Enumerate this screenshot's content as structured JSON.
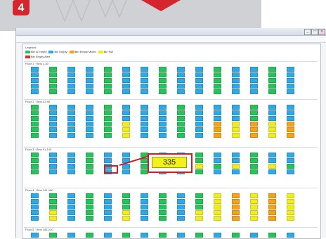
{
  "step_badge": {
    "number": "4",
    "color": "#d5262e"
  },
  "callout": {
    "value": "335"
  },
  "legend": {
    "title": "Legends",
    "items": [
      {
        "label": "Bin Is Empty",
        "color": "#26c35a"
      },
      {
        "label": "Bin Empty",
        "color": "#2fa8e6"
      },
      {
        "label": "Bin Empty Mixed",
        "color": "#f3a21b"
      },
      {
        "label": "Bin Full",
        "color": "#f0ec22"
      },
      {
        "label": "Bin Empty Alert",
        "color": "#e22a2a"
      }
    ]
  },
  "sections": [
    {
      "title": "Floor 1 · Bins 1-40"
    },
    {
      "title": "Floor 2 · Bins 41-90"
    },
    {
      "title": "Floor 3 · Bins 91-140"
    },
    {
      "title": "Floor 4 · Bins 141-180"
    },
    {
      "title": "Floor 5 · Bins 181-220"
    }
  ],
  "cells": [
    {
      "color": "#2fa8e6",
      "label": ""
    },
    {
      "color": "#26c35a",
      "label": ""
    },
    {
      "color": "#2fa8e6",
      "label": ""
    },
    {
      "color": "#2fa8e6",
      "label": ""
    },
    {
      "color": "#2fa8e6",
      "label": ""
    },
    {
      "color": "#2fa8e6",
      "label": ""
    },
    {
      "color": "#2fa8e6",
      "label": ""
    },
    {
      "color": "#26c35a",
      "label": ""
    },
    {
      "color": "#2fa8e6",
      "label": ""
    },
    {
      "color": "#26c35a",
      "label": ""
    },
    {
      "color": "#2fa8e6",
      "label": ""
    },
    {
      "color": "#2fa8e6",
      "label": ""
    },
    {
      "color": "#2fa8e6",
      "label": ""
    }
  ]
}
